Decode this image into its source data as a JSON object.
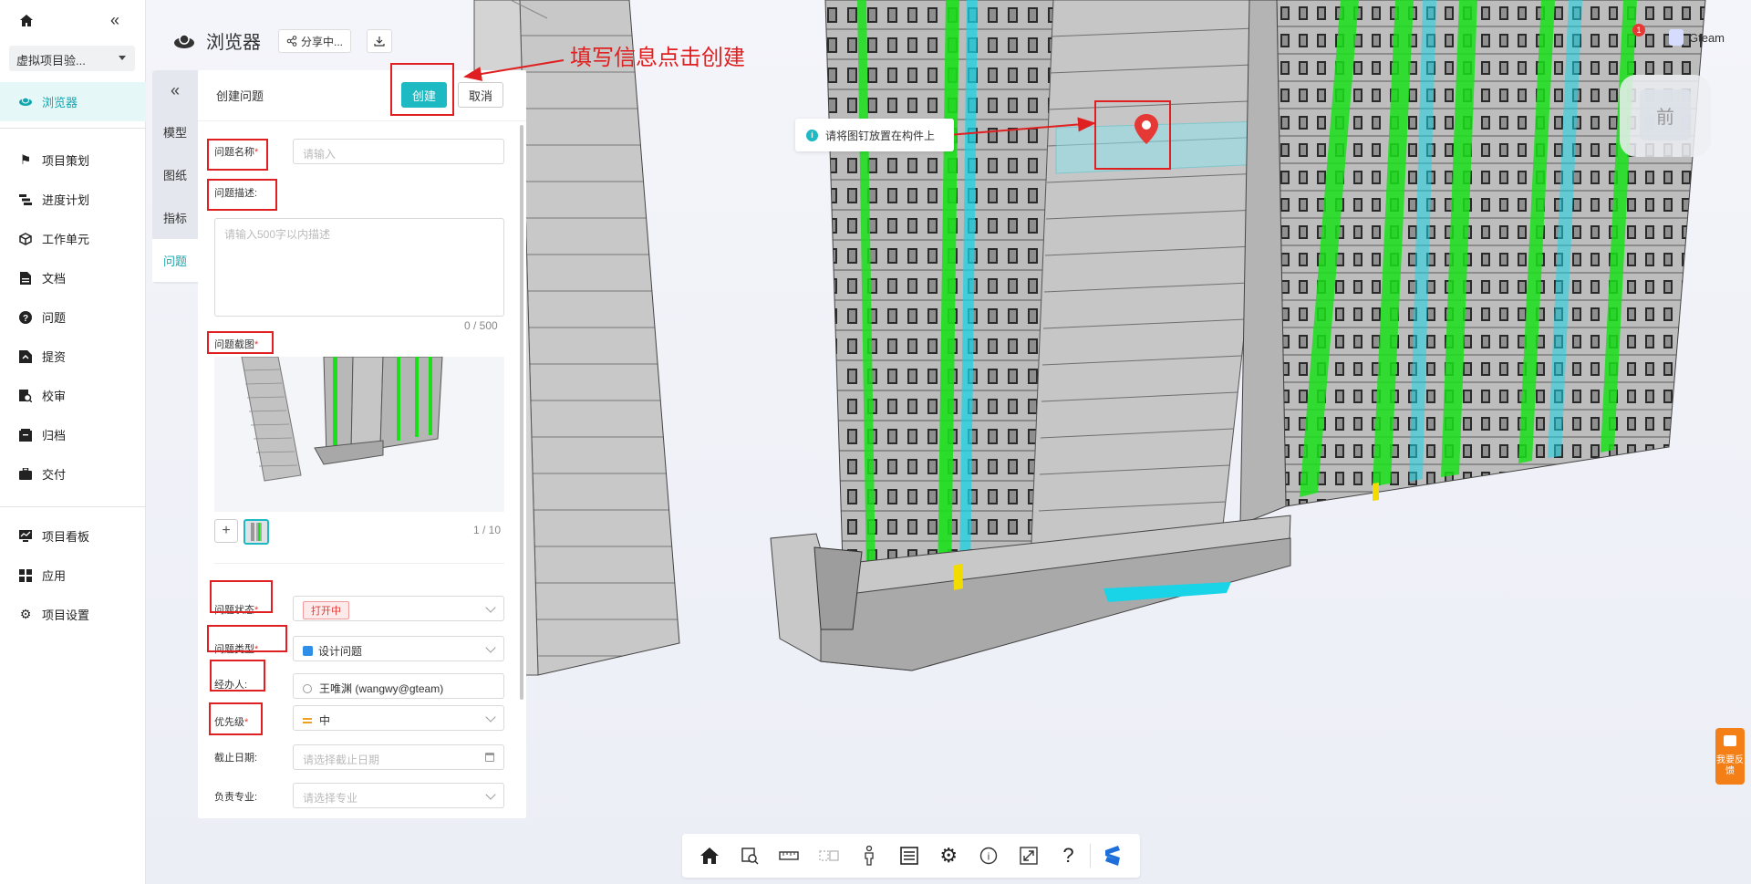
{
  "sidebar": {
    "project": "虚拟项目验...",
    "items": [
      {
        "label": "浏览器",
        "icon": "browser-icon"
      },
      {
        "label": "项目策划",
        "icon": "flag-icon"
      },
      {
        "label": "进度计划",
        "icon": "gantt-icon"
      },
      {
        "label": "工作单元",
        "icon": "cube-icon"
      },
      {
        "label": "文档",
        "icon": "document-icon"
      },
      {
        "label": "问题",
        "icon": "question-icon"
      },
      {
        "label": "提资",
        "icon": "submit-icon"
      },
      {
        "label": "校审",
        "icon": "review-icon"
      },
      {
        "label": "归档",
        "icon": "archive-icon"
      },
      {
        "label": "交付",
        "icon": "briefcase-icon"
      },
      {
        "label": "项目看板",
        "icon": "dashboard-icon"
      },
      {
        "label": "应用",
        "icon": "apps-icon"
      },
      {
        "label": "项目设置",
        "icon": "gear-icon"
      }
    ]
  },
  "header": {
    "title": "浏览器",
    "share_label": "分享中..."
  },
  "vtabs": [
    "模型",
    "图纸",
    "指标",
    "问题"
  ],
  "issue_panel": {
    "title": "创建问题",
    "create_label": "创建",
    "cancel_label": "取消",
    "name_label": "问题名称",
    "name_placeholder": "请输入",
    "desc_label": "问题描述:",
    "desc_placeholder": "请输入500字以内描述",
    "desc_count": "0 / 500",
    "shot_label": "问题截图",
    "shot_count": "1 / 10",
    "status_label": "问题状态",
    "status_value": "打开中",
    "type_label": "问题类型",
    "type_value": "设计问题",
    "assignee_label": "经办人:",
    "assignee_value": "王唯渊 (wangwy@gteam)",
    "priority_label": "优先级",
    "priority_value": "中",
    "deadline_label": "截止日期:",
    "deadline_placeholder": "请选择截止日期",
    "discipline_label": "负责专业:",
    "discipline_placeholder": "请选择专业"
  },
  "annotation": {
    "instruction": "填写信息点击创建",
    "tooltip": "请将图钉放置在构件上"
  },
  "topbar": {
    "user": "Gteam",
    "badge": "1"
  },
  "viewcube_label": "前",
  "feedback_label": "我要反馈",
  "colors": {
    "accent": "#1ebac3",
    "annotation": "#e02020",
    "green_elements": "#19e019",
    "cyan_elements": "#19d3e6"
  }
}
